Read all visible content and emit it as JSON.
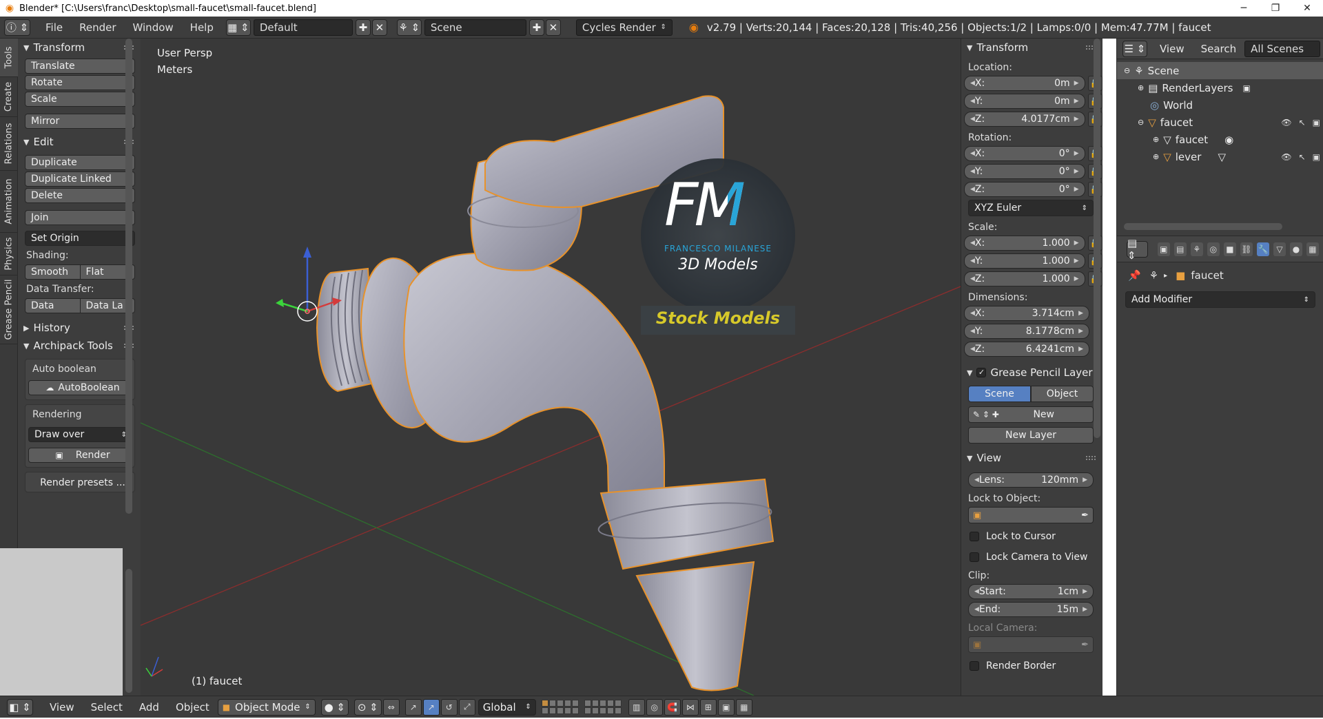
{
  "window": {
    "title": "Blender* [C:\\Users\\franc\\Desktop\\small-faucet\\small-faucet.blend]",
    "minimize": "─",
    "maximize": "❐",
    "close": "✕"
  },
  "header": {
    "menus": [
      "File",
      "Render",
      "Window",
      "Help"
    ],
    "layout": "Default",
    "scene": "Scene",
    "engine": "Cycles Render",
    "stats": "v2.79 | Verts:20,144 | Faces:20,128 | Tris:40,256 | Objects:1/2 | Lamps:0/0 | Mem:47.77M | faucet"
  },
  "vtabs": [
    "Tools",
    "Create",
    "Relations",
    "Animation",
    "Physics",
    "Grease Pencil"
  ],
  "toolshelf": {
    "transform_title": "Transform",
    "transform": [
      "Translate",
      "Rotate",
      "Scale"
    ],
    "mirror": "Mirror",
    "edit_title": "Edit",
    "edit": [
      "Duplicate",
      "Duplicate Linked",
      "Delete"
    ],
    "join": "Join",
    "set_origin": "Set Origin",
    "shading_label": "Shading:",
    "smooth": "Smooth",
    "flat": "Flat",
    "data_transfer_label": "Data Transfer:",
    "data": "Data",
    "data_la": "Data La",
    "history": "History",
    "archipack": "Archipack Tools",
    "auto_boolean_label": "Auto boolean",
    "auto_boolean_btn": "AutoBoolean",
    "rendering_label": "Rendering",
    "draw_over": "Draw over",
    "render": "Render",
    "render_presets": "Render presets ..."
  },
  "viewport": {
    "view_name": "User Persp",
    "units": "Meters",
    "object_label": "(1) faucet",
    "logo_line1": "FM",
    "logo_line2": "FRANCESCO MILANESE",
    "logo_line3": "3D Models",
    "logo_banner": "Stock Models",
    "colors": {
      "background": "#393939",
      "faucet": "#a9a9b6",
      "outline": "#e8922a",
      "grid_red": "#8c2d2d",
      "grid_green": "#2d6e2d",
      "logo_blue": "#29a5d8",
      "logo_yellow": "#d7c92a"
    }
  },
  "npanel": {
    "transform_title": "Transform",
    "location_label": "Location:",
    "location": [
      {
        "axis": "X:",
        "value": "0m"
      },
      {
        "axis": "Y:",
        "value": "0m"
      },
      {
        "axis": "Z:",
        "value": "4.0177cm"
      }
    ],
    "rotation_label": "Rotation:",
    "rotation": [
      {
        "axis": "X:",
        "value": "0°"
      },
      {
        "axis": "Y:",
        "value": "0°"
      },
      {
        "axis": "Z:",
        "value": "0°"
      }
    ],
    "rotation_mode": "XYZ Euler",
    "scale_label": "Scale:",
    "scale": [
      {
        "axis": "X:",
        "value": "1.000"
      },
      {
        "axis": "Y:",
        "value": "1.000"
      },
      {
        "axis": "Z:",
        "value": "1.000"
      }
    ],
    "dimensions_label": "Dimensions:",
    "dimensions": [
      {
        "axis": "X:",
        "value": "3.714cm"
      },
      {
        "axis": "Y:",
        "value": "8.1778cm"
      },
      {
        "axis": "Z:",
        "value": "6.4241cm"
      }
    ],
    "grease_title": "Grease Pencil Layer",
    "grease_scene": "Scene",
    "grease_object": "Object",
    "grease_new": "New",
    "grease_new_layer": "New Layer",
    "view_title": "View",
    "lens_label": "Lens:",
    "lens_value": "120mm",
    "lock_object_label": "Lock to Object:",
    "lock_cursor": "Lock to Cursor",
    "lock_camera": "Lock Camera to View",
    "clip_label": "Clip:",
    "clip_start_label": "Start:",
    "clip_start": "1cm",
    "clip_end_label": "End:",
    "clip_end": "15m",
    "local_camera_label": "Local Camera:",
    "render_border": "Render Border"
  },
  "outliner": {
    "view": "View",
    "search": "Search",
    "filter": "All Scenes",
    "items": [
      {
        "label": "Scene",
        "depth": 0
      },
      {
        "label": "RenderLayers",
        "depth": 1
      },
      {
        "label": "World",
        "depth": 1
      },
      {
        "label": "faucet",
        "depth": 1
      },
      {
        "label": "faucet",
        "depth": 2
      },
      {
        "label": "lever",
        "depth": 2
      }
    ]
  },
  "properties": {
    "object_name": "faucet",
    "add_modifier": "Add Modifier"
  },
  "bottombar": {
    "menus": [
      "View",
      "Select",
      "Add",
      "Object"
    ],
    "mode": "Object Mode",
    "orientation": "Global"
  }
}
